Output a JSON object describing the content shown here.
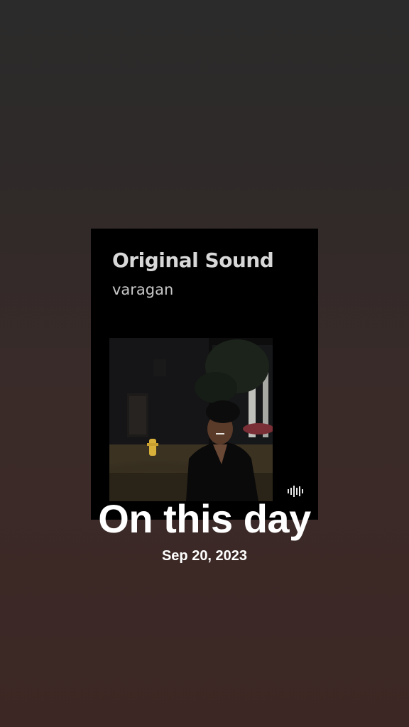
{
  "sound_card": {
    "title": "Original Sound",
    "artist": "varagan",
    "waveform_icon": "waveform-icon"
  },
  "memory": {
    "title": "On this day",
    "date": "Sep 20, 2023"
  },
  "colors": {
    "background_top": "#2b2b2b",
    "background_bottom": "#3d2724",
    "card": "#000000",
    "text": "#ffffff"
  }
}
